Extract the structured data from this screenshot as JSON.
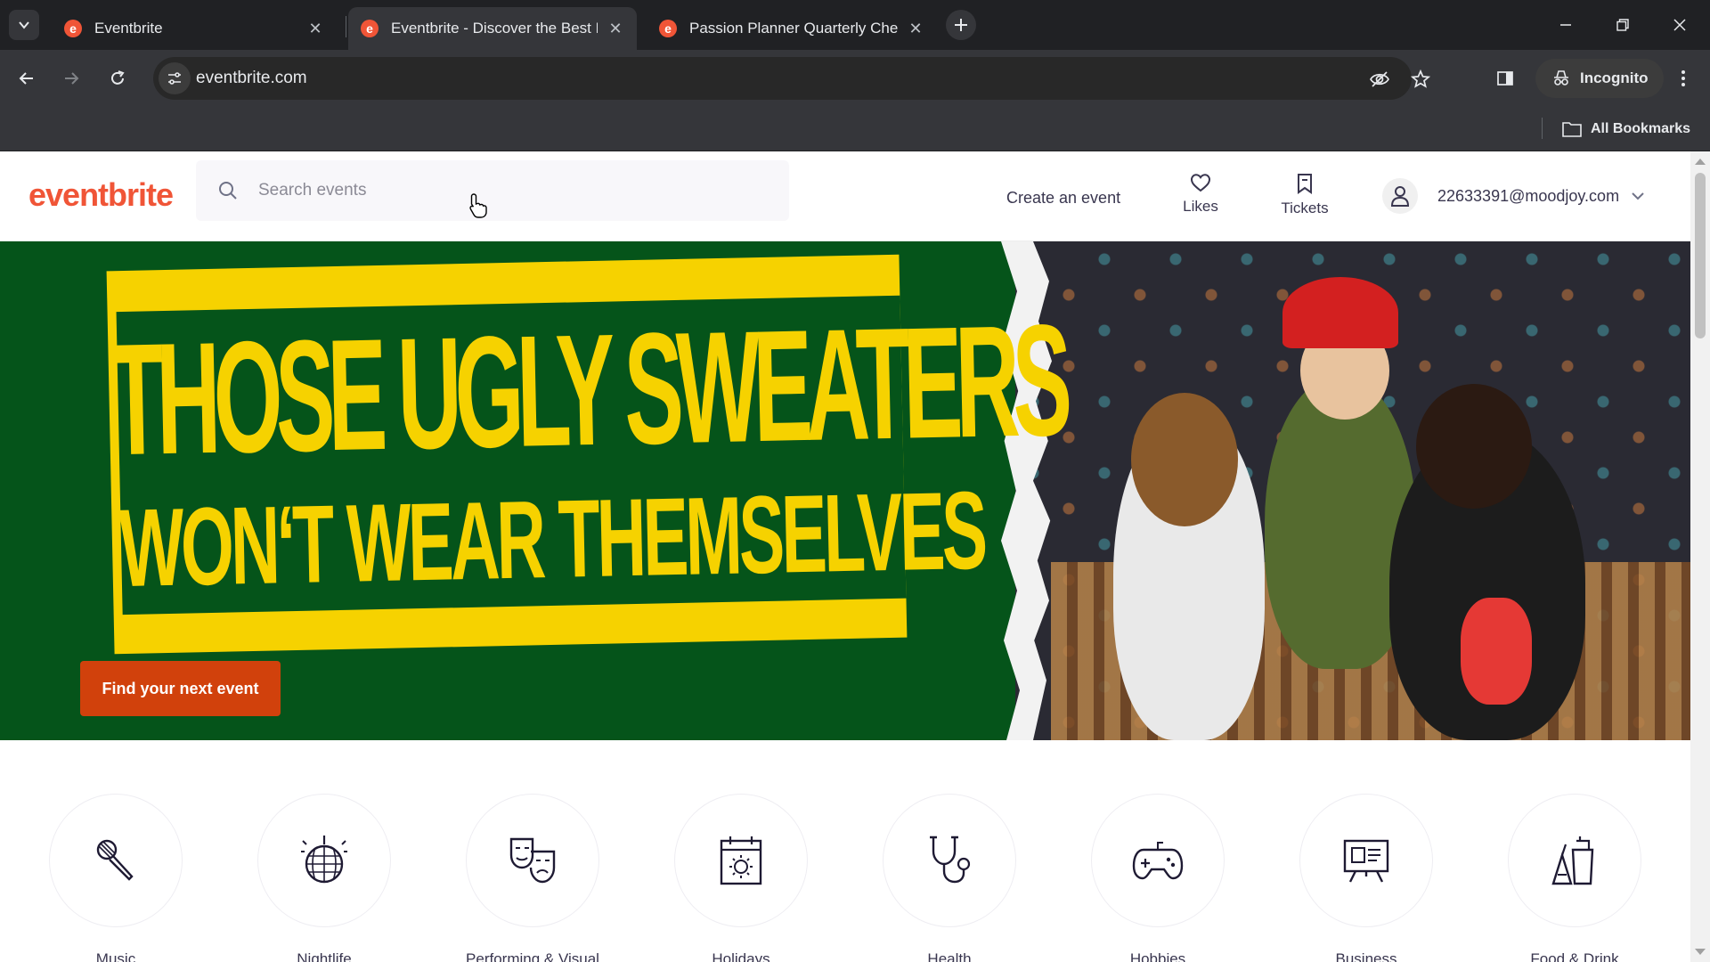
{
  "browser": {
    "tabs": [
      {
        "title": "Eventbrite",
        "active": false
      },
      {
        "title": "Eventbrite - Discover the Best Local Events",
        "active": true
      },
      {
        "title": "Passion Planner Quarterly Check-in",
        "active": false
      }
    ],
    "url": "eventbrite.com",
    "incognito_label": "Incognito",
    "all_bookmarks_label": "All Bookmarks"
  },
  "header": {
    "logo": "eventbrite",
    "search_placeholder": "Search events",
    "create_event": "Create an event",
    "likes": "Likes",
    "tickets": "Tickets",
    "user_email": "22633391@moodjoy.com"
  },
  "hero": {
    "line1": "THOSE UGLY SWEATERS",
    "line2": "WON‘T WEAR THEMSELVES",
    "cta": "Find your next event"
  },
  "categories": [
    {
      "label": "Music",
      "icon": "microphone-icon"
    },
    {
      "label": "Nightlife",
      "icon": "disco-ball-icon"
    },
    {
      "label": "Performing & Visual",
      "icon": "theater-masks-icon"
    },
    {
      "label": "Holidays",
      "icon": "calendar-sun-icon"
    },
    {
      "label": "Health",
      "icon": "stethoscope-icon"
    },
    {
      "label": "Hobbies",
      "icon": "gamepad-icon"
    },
    {
      "label": "Business",
      "icon": "presentation-board-icon"
    },
    {
      "label": "Food & Drink",
      "icon": "drinks-icon"
    }
  ],
  "colors": {
    "brand": "#f05537",
    "cta": "#d1410c",
    "hero_green": "#05541a",
    "hero_yellow": "#f6d200"
  }
}
